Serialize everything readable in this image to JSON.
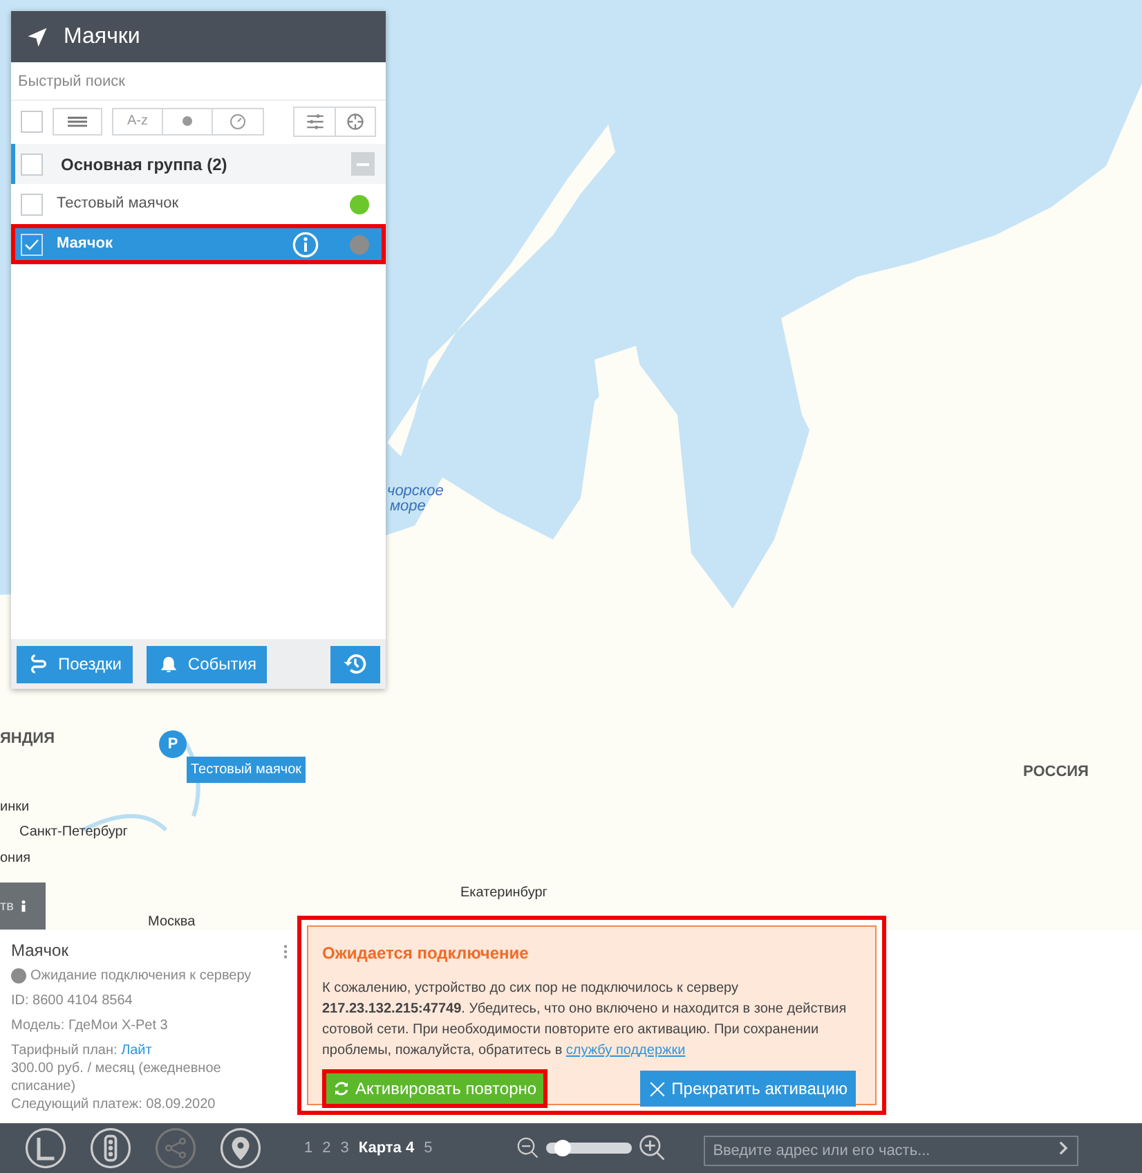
{
  "panel": {
    "title": "Маячки",
    "search": {
      "placeholder": "Быстрый поиск"
    },
    "select_all": {
      "checked": false
    },
    "sort_label": "A-z",
    "groups": [
      {
        "name": "Основная группа (2)",
        "checked": false,
        "expanded": true,
        "children": [
          {
            "name": "Тестовый маячок",
            "checked": false,
            "selected": false,
            "color": "#6cc72c"
          },
          {
            "name": "Маячок",
            "checked": true,
            "selected": true,
            "color": "#8c8c8c"
          }
        ]
      }
    ],
    "buttons": [
      "Поездки",
      "События"
    ]
  },
  "map": {
    "labels": [
      {
        "text": "чорское",
        "kind": "sea"
      },
      {
        "text": "море",
        "kind": "sea"
      },
      {
        "text": "ЯНДИЯ",
        "kind": "country"
      },
      {
        "text": "инки",
        "kind": "city"
      },
      {
        "text": "Санкт-Петербург",
        "kind": "city"
      },
      {
        "text": "ония",
        "kind": "city"
      },
      {
        "text": "Москва",
        "kind": "city"
      },
      {
        "text": "Екатеринбург",
        "kind": "city"
      },
      {
        "text": "РОССИЯ",
        "kind": "country"
      }
    ],
    "marker": {
      "letter": "P",
      "label": "Тестовый маячок"
    },
    "side_tab": "тв"
  },
  "info": {
    "name": "Маячок",
    "status": "Ожидание подключения к серверу",
    "id": "ID: 8600 4104 8564",
    "model": "Модель: ГдеМои X-Pet 3",
    "plan_label": "Тарифный план:",
    "plan": "Лайт",
    "price": "300.00 руб. / месяц (ежедневное списание)",
    "next_payment": "Следующий платеж: 08.09.2020"
  },
  "alert": {
    "title": "Ожидается подключение",
    "text": "К сожалению, устройство до сих пор не подключилось к серверу **217.23.132.215:47749**. Убедитесь, что оно включено и находится в зоне действия сотовой сети. При необходимости повторите его активацию. При сохранении проблемы, пожалуйста, обратитесь в",
    "link": "службу поддержки",
    "buttons": [
      {
        "label": "Активировать повторно",
        "kind": "primary"
      },
      {
        "label": "Прекратить активацию",
        "kind": "secondary"
      }
    ]
  },
  "bottom_bar": {
    "pages": [
      {
        "label": "1",
        "selected": false
      },
      {
        "label": "2",
        "selected": false
      },
      {
        "label": "3",
        "selected": false
      },
      {
        "label": "Карта 4",
        "selected": true
      },
      {
        "label": "5",
        "selected": false
      }
    ],
    "zoom": {
      "level": 0.12
    },
    "address": {
      "placeholder": "Введите адрес или его часть..."
    }
  }
}
